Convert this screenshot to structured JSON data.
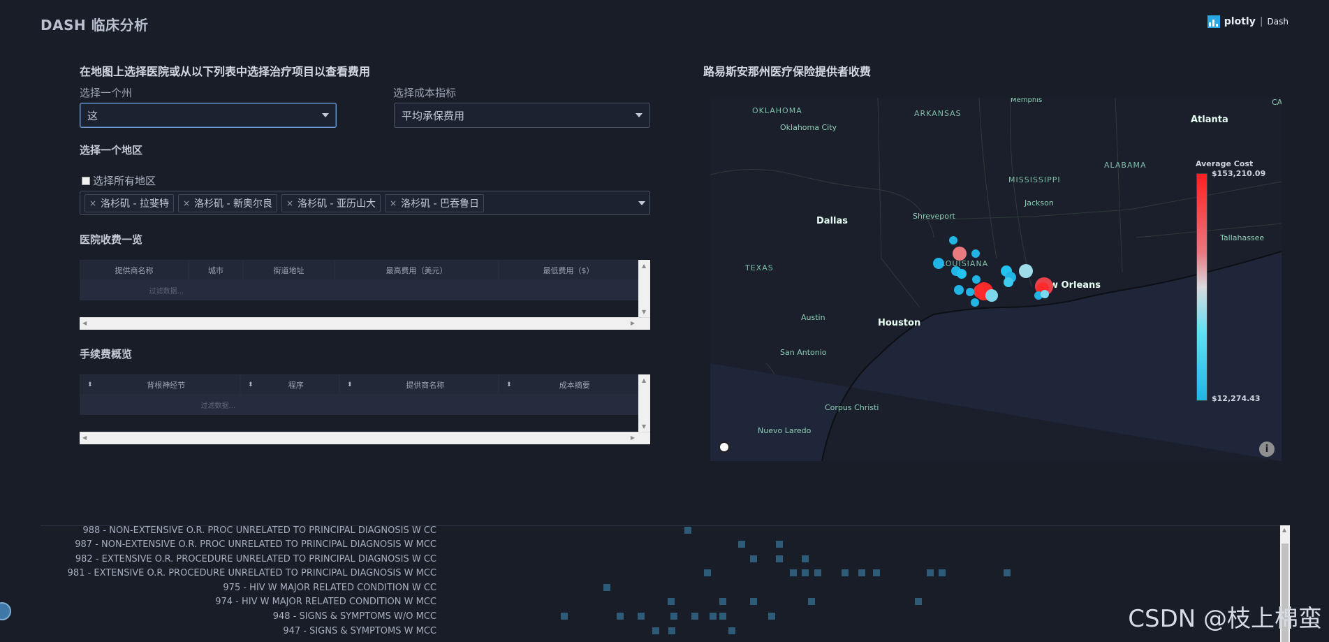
{
  "app": {
    "title": "DASH 临床分析",
    "logo_text": "plotly",
    "logo_sub": "Dash"
  },
  "left": {
    "heading": "在地图上选择医院或从以下列表中选择治疗项目以查看费用",
    "state_label": "选择一个州",
    "state_value": "这",
    "cost_label": "选择成本指标",
    "cost_value": "平均承保费用",
    "region_label": "选择一个地区",
    "select_all_label": "选择所有地区",
    "regions": [
      "洛杉矶 - 拉斐特",
      "洛杉矶 - 新奥尔良",
      "洛杉矶 - 亚历山大",
      "洛杉矶 - 巴吞鲁日"
    ],
    "hospital_table_title": "医院收费一览",
    "hospital_columns": [
      "提供商名称",
      "城市",
      "街道地址",
      "最高费用（美元）",
      "最低费用（$）"
    ],
    "hospital_filter": "过滤数据...",
    "procedure_table_title": "手续费概览",
    "procedure_columns": [
      "背根神经节",
      "程序",
      "提供商名称",
      "成本摘要"
    ],
    "procedure_filter": "过滤数据..."
  },
  "map": {
    "title": "路易斯安那州医疗保险提供者收费",
    "colorbar_title": "Average Cost",
    "colorbar_max": "$153,210.09",
    "colorbar_min": "$12,274.43",
    "labels": {
      "oklahoma": "OKLAHOMA",
      "oklahoma_city": "Oklahoma City",
      "arkansas": "ARKANSAS",
      "memphis": "Memphis",
      "atlanta": "Atlanta",
      "alabama": "ALABAMA",
      "mississippi": "MISSISSIPPI",
      "jackson": "Jackson",
      "dallas": "Dallas",
      "shreveport": "Shreveport",
      "louisiana": "LOUISIANA",
      "texas": "TEXAS",
      "tallahassee": "Tallahassee",
      "new_orleans": "w Orleans",
      "austin": "Austin",
      "houston": "Houston",
      "san_antonio": "San Antonio",
      "corpus_christi": "Corpus Christi",
      "nuevo_laredo": "Nuevo Laredo",
      "edge_ca": "CA"
    },
    "colors": {
      "low": "#22c4ef",
      "mid": "#d9d9de",
      "high": "#ff2b2b"
    }
  },
  "heatmap": {
    "rows": [
      "988 - NON-EXTENSIVE O.R. PROC UNRELATED TO PRINCIPAL DIAGNOSIS W CC",
      "987 - NON-EXTENSIVE O.R. PROC UNRELATED TO PRINCIPAL DIAGNOSIS W MCC",
      "982 - EXTENSIVE O.R. PROCEDURE UNRELATED TO PRINCIPAL DIAGNOSIS W CC",
      "981 - EXTENSIVE O.R. PROCEDURE UNRELATED TO PRINCIPAL DIAGNOSIS W MCC",
      "975 - HIV W MAJOR RELATED CONDITION W CC",
      "974 - HIV W MAJOR RELATED CONDITION W MCC",
      "948 - SIGNS & SYMPTOMS W/O MCC",
      "947 - SIGNS & SYMPTOMS W MCC"
    ]
  },
  "watermark": "CSDN @枝上棉蛮"
}
